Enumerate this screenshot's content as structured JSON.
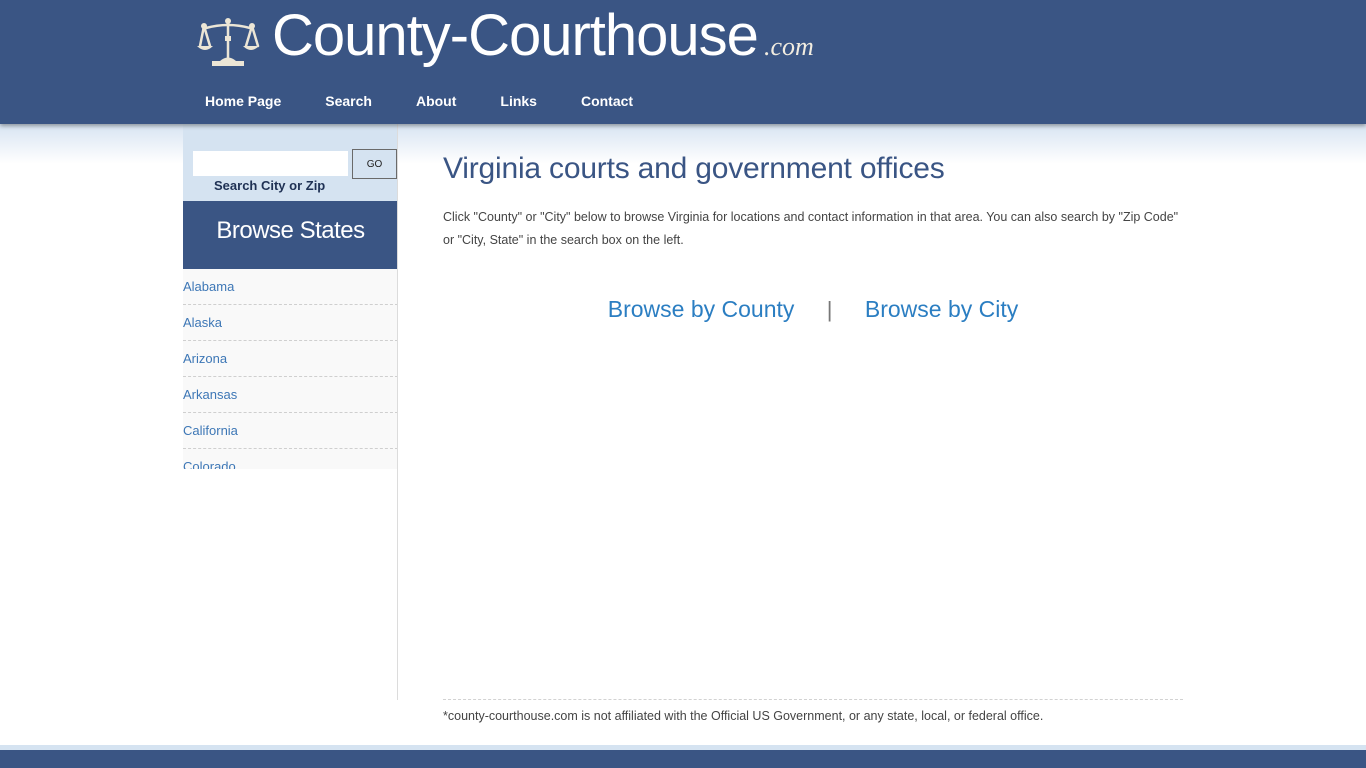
{
  "header": {
    "title": "County-Courthouse",
    "tld": ".com",
    "logo_icon": "scales-of-justice-icon"
  },
  "nav": [
    {
      "label": "Home Page"
    },
    {
      "label": "Search"
    },
    {
      "label": "About"
    },
    {
      "label": "Links"
    },
    {
      "label": "Contact"
    }
  ],
  "sidebar": {
    "search": {
      "value": "",
      "placeholder": "",
      "go_label": "GO",
      "label": "Search City or Zip"
    },
    "browse_heading": "Browse States",
    "states": [
      {
        "label": "Alabama"
      },
      {
        "label": "Alaska"
      },
      {
        "label": "Arizona"
      },
      {
        "label": "Arkansas"
      },
      {
        "label": "California"
      },
      {
        "label": "Colorado"
      }
    ]
  },
  "main": {
    "title": "Virginia courts and government offices",
    "intro": "Click \"County\" or \"City\" below to browse Virginia for locations and contact information in that area.  You can also search by \"Zip Code\" or \"City, State\" in the search box on the left.",
    "browse_county": "Browse by County",
    "separator": "|",
    "browse_city": "Browse by City"
  },
  "footer": {
    "disclaimer": "*county-courthouse.com is not affiliated with the Official US Government, or any state, local, or federal office."
  },
  "colors": {
    "brand": "#3a5584",
    "link": "#2b7ec2",
    "sidebar_bg": "#d5e3f1"
  }
}
